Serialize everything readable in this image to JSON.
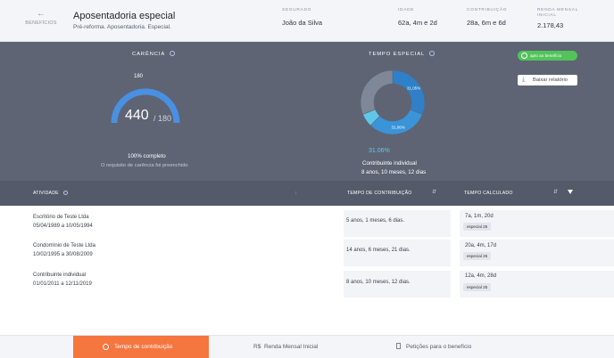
{
  "header": {
    "back_label": "BENEFÍCIOS",
    "title": "Aposentadoria especial",
    "subtitle": "Pré-reforma. Aposentadoria. Especial.",
    "segurado_label": "SEGURADO",
    "segurado_value": "João da Silva",
    "idade_label": "IDADE",
    "idade_value": "62a, 4m e 2d",
    "contribuicao_label": "CONTRIBUIÇÃO",
    "contribuicao_value": "28a, 6m e 6d",
    "renda_label_1": "RENDA MENSAL",
    "renda_label_2": "INICIAL",
    "renda_value": "2.178,43"
  },
  "carencia": {
    "label": "CARÊNCIA",
    "max": "180",
    "value": "440",
    "separator": "/ 180",
    "complete": "100% completo",
    "requirement": "O requisito de carência foi preenchido",
    "fill_fraction": 1.0
  },
  "tempo_especial": {
    "label": "TEMPO ESPECIAL",
    "segments": [
      {
        "label": "31,05%",
        "value": 31.05,
        "color": "#2f80c8"
      },
      {
        "label": "31,06%",
        "value": 31.06,
        "color": "#3a94d8"
      },
      {
        "label": "",
        "value": 6.83,
        "color": "#5fc8e8"
      },
      {
        "label": "",
        "value": 31.06,
        "color": "#7f8898"
      }
    ],
    "percent": "31.06%",
    "contributor": "Contribuinte individual",
    "duration": "8 anos, 10 meses, 12 dias"
  },
  "actions": {
    "apto": "apto ao benefício",
    "baixar": "Baixar relatório"
  },
  "table": {
    "col_atividade": "ATIVIDADE",
    "col_tempo": "TEMPO DE CONTRIBUIÇÃO",
    "col_calculado": "TEMPO CALCULADO",
    "rows": [
      {
        "name": "Escritório de Teste Ltda",
        "dates": "05/04/1989 a 10/05/1994",
        "tempo": "5 anos, 1 meses, 6 dias.",
        "calc": "7a, 1m, 20d",
        "badge": "especial 25"
      },
      {
        "name": "Condomínio de Teste Ltda",
        "dates": "10/02/1995 a 30/08/2009",
        "tempo": "14 anos, 6 meses, 21 dias.",
        "calc": "20a, 4m, 17d",
        "badge": "especial 25"
      },
      {
        "name": "Contribuinte individual",
        "dates": "01/01/2011 a 12/11/2019",
        "tempo": "8 anos, 10 meses, 12 dias.",
        "calc": "12a, 4m, 28d",
        "badge": "especial 25"
      }
    ]
  },
  "bottom": {
    "tab1": "Tempo de contribuição",
    "tab2_prefix": "R$",
    "tab2": "Renda Mensal Inicial",
    "tab3": "Petições para o benefício"
  }
}
